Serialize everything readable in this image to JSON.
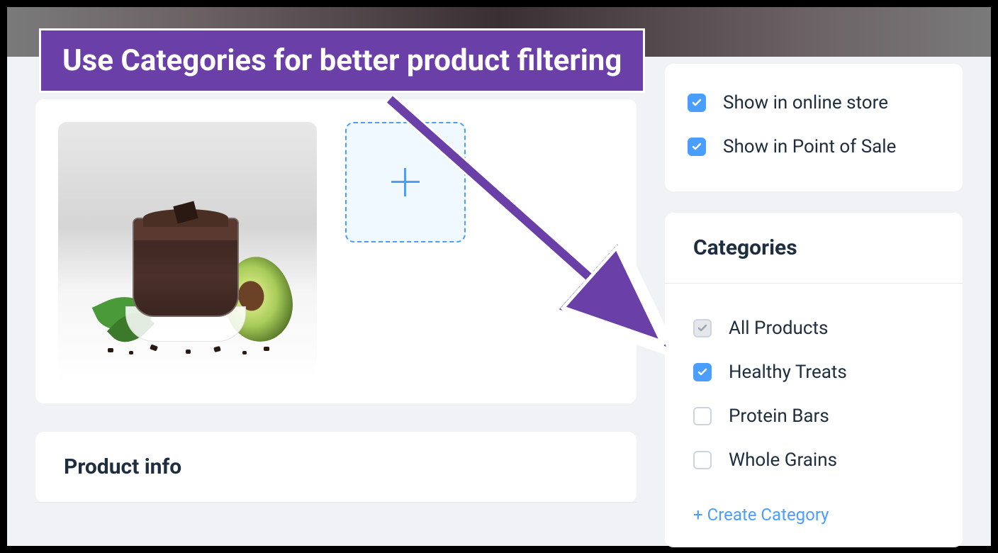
{
  "callout": {
    "text": "Use Categories for better product filtering"
  },
  "visibility": {
    "items": [
      {
        "label": "Show in online store",
        "checked": true
      },
      {
        "label": "Show in Point of Sale",
        "checked": true
      }
    ]
  },
  "product_info": {
    "title": "Product info"
  },
  "categories": {
    "title": "Categories",
    "items": [
      {
        "label": "All Products",
        "checked": true,
        "type": "gray"
      },
      {
        "label": "Healthy Treats",
        "checked": true,
        "type": "blue"
      },
      {
        "label": "Protein Bars",
        "checked": false,
        "type": "blue"
      },
      {
        "label": "Whole Grains",
        "checked": false,
        "type": "blue"
      }
    ],
    "create_label": "+ Create Category"
  }
}
